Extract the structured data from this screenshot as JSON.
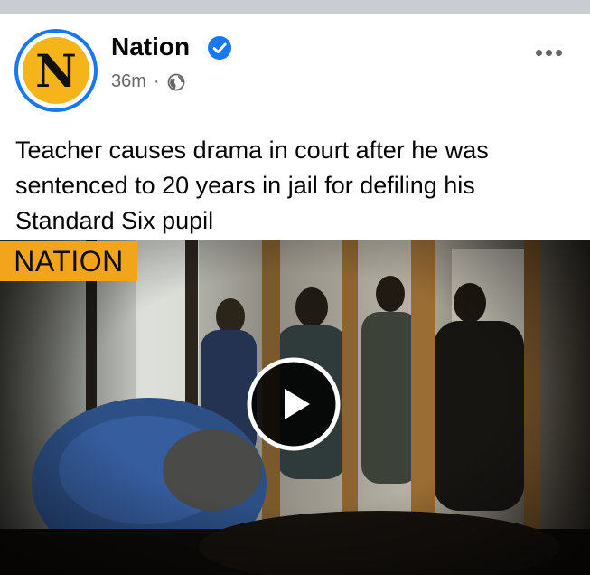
{
  "post": {
    "page_name": "Nation",
    "avatar_letter": "N",
    "time": "36m",
    "separator": "·",
    "audience_icon": "globe-icon",
    "verified_icon": "verified-badge-icon",
    "more_icon": "more-options-icon",
    "headline": "Teacher causes drama in court after he was sentenced to 20 years in jail for defiling his Standard Six pupil"
  },
  "video": {
    "logo_text": "NATION",
    "play_icon": "play-icon"
  },
  "colors": {
    "verified": "#1877f2",
    "avatar_ring": "#1877f2",
    "avatar_fill": "#f4b41a",
    "logo_fill": "#f2a51a",
    "meta_text": "#65676b"
  }
}
